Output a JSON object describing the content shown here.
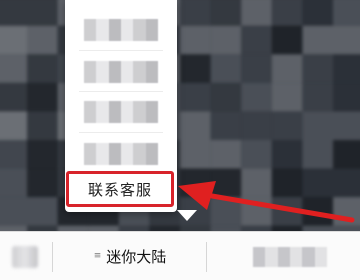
{
  "popup_menu": {
    "items": [
      {
        "label": "",
        "state": "obscured"
      },
      {
        "label": "",
        "state": "obscured"
      },
      {
        "label": "",
        "state": "obscured"
      },
      {
        "label": "",
        "state": "obscured"
      },
      {
        "label": "联系客服",
        "state": "highlighted"
      }
    ],
    "highlight_color": "#d8232a"
  },
  "bottom_bar": {
    "left_icon": "keyboard-icon",
    "active_tab": {
      "icon": "menu-list-icon",
      "icon_glyph": "≡",
      "label": "迷你大陆"
    },
    "right_tab": {
      "label": ""
    }
  },
  "annotation": {
    "type": "arrow",
    "color": "#e02020",
    "points_to": "联系客服"
  },
  "background": {
    "style": "mosaic-obscured"
  }
}
